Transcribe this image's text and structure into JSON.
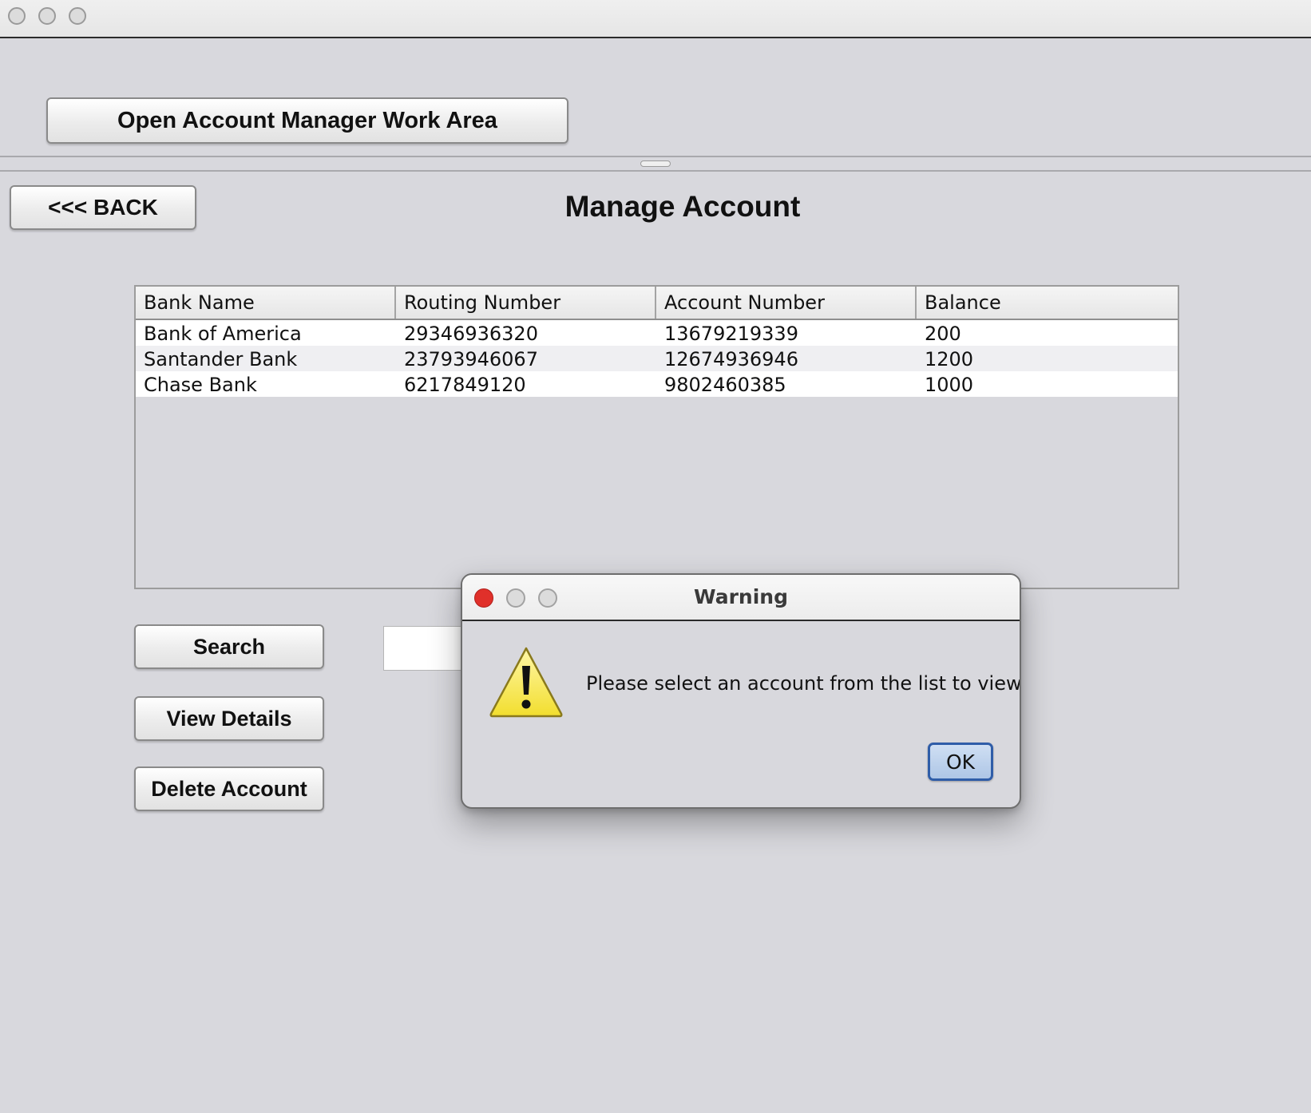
{
  "window": {
    "traffic_lights": [
      "circle-icon",
      "circle-icon",
      "circle-icon"
    ]
  },
  "toolbar": {
    "open_work_area_label": "Open Account Manager Work Area"
  },
  "page": {
    "back_label": "<<< BACK",
    "title": "Manage Account"
  },
  "table": {
    "columns": [
      "Bank Name",
      "Routing Number",
      "Account Number",
      "Balance"
    ],
    "rows": [
      [
        "Bank of America",
        "29346936320",
        "13679219339",
        "200"
      ],
      [
        "Santander Bank",
        "23793946067",
        "12674936946",
        "1200"
      ],
      [
        "Chase Bank",
        "6217849120",
        "9802460385",
        "1000"
      ]
    ]
  },
  "actions": {
    "search_label": "Search",
    "view_details_label": "View Details",
    "delete_account_label": "Delete Account",
    "search_value": ""
  },
  "dialog": {
    "title": "Warning",
    "icon": "warning-icon",
    "message": "Please select an account from the list to view",
    "ok_label": "OK"
  },
  "colors": {
    "background": "#d8d8dd",
    "close_red": "#e0302a",
    "ok_border": "#2f5da8",
    "warning_yellow": "#f7e64a"
  }
}
